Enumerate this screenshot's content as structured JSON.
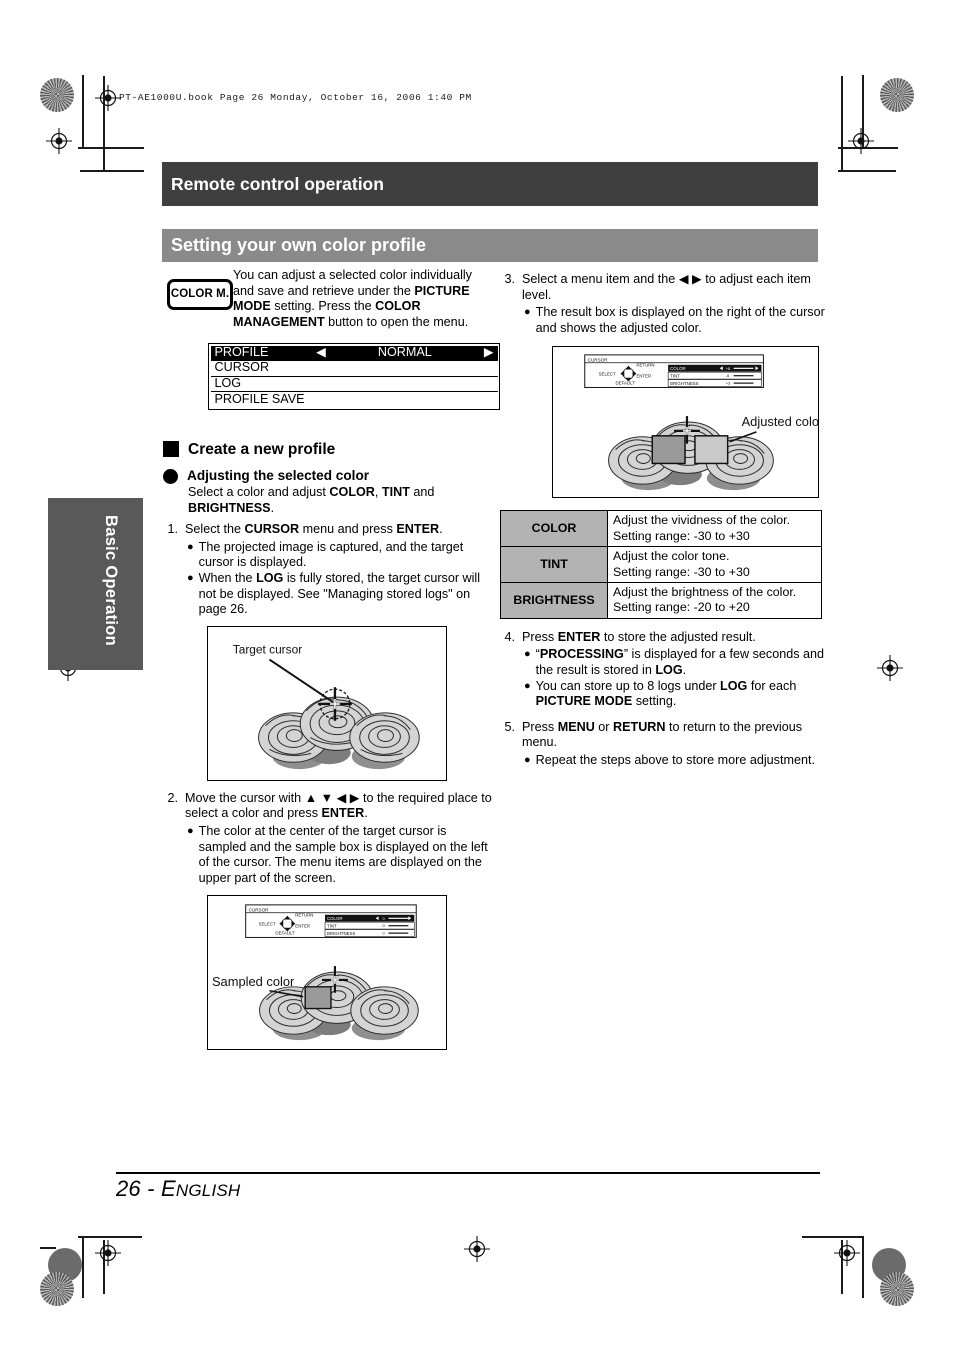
{
  "document": {
    "book_header": "PT-AE1000U.book   Page 26   Monday, October 16, 2006   1:40 PM",
    "page_footer_number": "26 - ",
    "page_footer_lang_first": "E",
    "page_footer_lang_rest": "NGLISH",
    "side_tab_label": "Basic Operation"
  },
  "headers": {
    "chapter_bar": "Remote control operation",
    "section_bar": "Setting your own color profile"
  },
  "intro": {
    "key_label": "COLOR M.",
    "text_1": "You can adjust a selected color individually and save and retrieve under the ",
    "bold_1": "PICTURE MODE",
    "text_2": " setting. Press the ",
    "bold_2": "COLOR MANAGEMENT",
    "text_3": " button to open the menu."
  },
  "profile_menu": {
    "rows": [
      {
        "label": "PROFILE",
        "value": "NORMAL",
        "selected": true
      },
      {
        "label": "CURSOR",
        "value": "",
        "selected": false
      },
      {
        "label": "LOG",
        "value": "",
        "selected": false
      },
      {
        "label": "PROFILE SAVE",
        "value": "",
        "selected": false
      }
    ],
    "left_arrow": "◀",
    "right_arrow": "▶"
  },
  "headings": {
    "create_profile": "Create a new profile",
    "adjusting_color": "Adjusting the selected color"
  },
  "lead": {
    "text_1": "Select a color and adjust ",
    "bold_1": "COLOR",
    "text_2": ", ",
    "bold_2": "TINT",
    "text_3": " and ",
    "bold_3": "BRIGHTNESS",
    "text_4": "."
  },
  "steps": {
    "s1": {
      "num": "1.",
      "t1": "Select the ",
      "b1": "CURSOR",
      "t2": " menu and press ",
      "b2": "ENTER",
      "t3": ".",
      "bullets": [
        {
          "t1": "The projected image is captured, and the target cursor is displayed."
        },
        {
          "t1": "When the ",
          "b1": "LOG",
          "t2": " is fully stored, the target cursor will not be displayed. See \"Managing stored logs\" on page 26."
        }
      ]
    },
    "s2": {
      "num": "2.",
      "t1": "Move the cursor with ",
      "arrows": "▲ ▼ ◀ ▶",
      "t2": " to the required place to select a color and press ",
      "b2": "ENTER",
      "t3": ".",
      "bullets": [
        {
          "t1": "The color at the center of the target cursor is sampled and the sample box is displayed on the left of the cursor. The menu items are displayed on the upper part of the screen."
        }
      ]
    },
    "s3": {
      "num": "3.",
      "t1": "Select a menu item and the ",
      "arrows": "◀ ▶",
      "t2": " to adjust each item level.",
      "bullets": [
        {
          "t1": "The result box is displayed on the right of the cursor and shows the adjusted color."
        }
      ]
    },
    "s4": {
      "num": "4.",
      "t1": "Press ",
      "b1": "ENTER",
      "t2": " to store the adjusted result.",
      "bullets": [
        {
          "t0": "“",
          "b1": "PROCESSING",
          "t1": "” is displayed for a few seconds and the result is stored in ",
          "b2": "LOG",
          "t2": "."
        },
        {
          "t1": "You can store up to 8 logs under ",
          "b1": "LOG",
          "t2": " for each ",
          "b2": "PICTURE MODE",
          "t3": " setting."
        }
      ]
    },
    "s5": {
      "num": "5.",
      "t1": "Press ",
      "b1": "MENU",
      "t2": " or ",
      "b2": "RETURN",
      "t3": " to return to the previous menu.",
      "bullets": [
        {
          "t1": "Repeat the steps above to store more adjustment."
        }
      ]
    }
  },
  "figures": {
    "fig1": {
      "caption": "Target cursor"
    },
    "fig2": {
      "caption": "Sampled color",
      "osd_title": "CURSOR",
      "osd_return": "RETURN",
      "osd_select": "SELECT",
      "osd_enter": "ENTER",
      "osd_default": "DEFAULT",
      "items": [
        {
          "label": "COLOR",
          "value": "0"
        },
        {
          "label": "TINT",
          "value": "0"
        },
        {
          "label": "BRIGHTNESS",
          "value": "0"
        }
      ]
    },
    "fig3": {
      "caption": "Adjusted color",
      "osd_title": "CURSOR",
      "osd_return": "RETURN",
      "osd_select": "SELECT",
      "osd_enter": "ENTER",
      "osd_default": "DEFAULT",
      "items": [
        {
          "label": "COLOR",
          "value": "+8"
        },
        {
          "label": "TINT",
          "value": "-5"
        },
        {
          "label": "BRIGHTNESS",
          "value": "+3"
        }
      ]
    }
  },
  "spec_table": {
    "rows": [
      {
        "label": "COLOR",
        "desc": "Adjust the vividness of the color.",
        "range": "Setting range: -30 to +30"
      },
      {
        "label": "TINT",
        "desc": "Adjust the color tone.",
        "range": "Setting range: -30 to +30"
      },
      {
        "label": "BRIGHTNESS",
        "desc": "Adjust the brightness of the color.",
        "range": "Setting range: -20 to +20"
      }
    ]
  },
  "colors": {
    "chapter_bar_bg": "#3f3f3f",
    "section_bar_bg": "#8a8a8a",
    "side_tab_bg": "#595959",
    "table_label_bg": "#b3b3b3",
    "rose_light": "#d4d4d4",
    "rose_shadow": "#8f8f8f",
    "sampled_swatch": "#9a9a9a",
    "adjusted_swatch": "#c9c9c9"
  }
}
